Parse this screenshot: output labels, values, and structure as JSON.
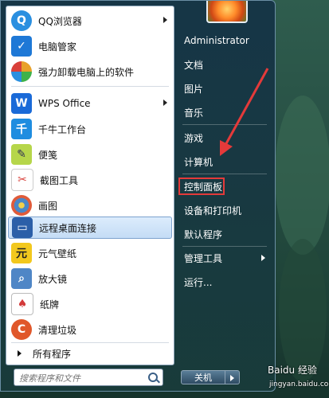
{
  "programs": [
    {
      "label": "QQ浏览器",
      "icon": "qq-browser-icon",
      "arrow": true,
      "color": "#2a8fe0"
    },
    {
      "label": "电脑管家",
      "icon": "pc-manager-icon",
      "arrow": false,
      "color": "#1e78d6"
    },
    {
      "label": "强力卸载电脑上的软件",
      "icon": "uninstaller-icon",
      "arrow": false,
      "color": "#e8a12a"
    },
    {
      "label": "WPS Office",
      "icon": "wps-office-icon",
      "arrow": true,
      "color": "#1a6ad8"
    },
    {
      "label": "千牛工作台",
      "icon": "qianniu-icon",
      "arrow": false,
      "color": "#1f8de0"
    },
    {
      "label": "便笺",
      "icon": "sticky-notes-icon",
      "arrow": false,
      "color": "#b6d64a"
    },
    {
      "label": "截图工具",
      "icon": "snipping-tool-icon",
      "arrow": false,
      "color": "#d9403a"
    },
    {
      "label": "画图",
      "icon": "paint-icon",
      "arrow": false,
      "color": "#4a87c8"
    },
    {
      "label": "远程桌面连接",
      "icon": "remote-desktop-icon",
      "arrow": false,
      "color": "#2b5fa8",
      "selected": true
    },
    {
      "label": "元气壁纸",
      "icon": "wallpaper-icon",
      "arrow": false,
      "color": "#f2c81e"
    },
    {
      "label": "放大镜",
      "icon": "magnifier-icon",
      "arrow": false,
      "color": "#4f86c6"
    },
    {
      "label": "纸牌",
      "icon": "solitaire-icon",
      "arrow": false,
      "color": "#d33a3a"
    },
    {
      "label": "清理垃圾",
      "icon": "cleanup-icon",
      "arrow": false,
      "color": "#e0572a"
    }
  ],
  "all_programs": "所有程序",
  "search": {
    "placeholder": "搜索程序和文件"
  },
  "right_items": [
    {
      "label": "Administrator",
      "arrow": false
    },
    {
      "label": "文档",
      "arrow": false
    },
    {
      "label": "图片",
      "arrow": false
    },
    {
      "label": "音乐",
      "arrow": false
    },
    {
      "label": "游戏",
      "arrow": false
    },
    {
      "label": "计算机",
      "arrow": false
    },
    {
      "label": "控制面板",
      "arrow": false,
      "highlighted": true
    },
    {
      "label": "设备和打印机",
      "arrow": false
    },
    {
      "label": "默认程序",
      "arrow": false
    },
    {
      "label": "管理工具",
      "arrow": true
    },
    {
      "label": "运行...",
      "arrow": false
    }
  ],
  "shutdown_label": "关机",
  "watermark": {
    "brand": "Baidu 经验",
    "url": "jingyan.baidu.com"
  },
  "colors": {
    "highlight": "#e43a3a",
    "selection": "#c4dcf5"
  }
}
